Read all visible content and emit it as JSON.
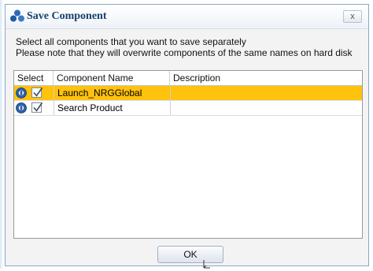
{
  "dialog": {
    "title": "Save Component",
    "close_label": "x",
    "app_icon": "components-icon"
  },
  "instructions": {
    "line1": "Select all components that you want to save separately",
    "line2": "Please note that they will overwrite components of the same names on hard disk"
  },
  "grid": {
    "columns": [
      "Select",
      "Component Name",
      "Description"
    ],
    "rows": [
      {
        "checked": true,
        "name": "Launch_NRGGlobal",
        "description": "",
        "selected": true,
        "icon": "component-icon"
      },
      {
        "checked": true,
        "name": "Search Product",
        "description": "",
        "selected": false,
        "icon": "component-icon"
      }
    ]
  },
  "buttons": {
    "ok_label": "OK"
  },
  "colors": {
    "selected_row": "#ffc20d",
    "title_text": "#16416f",
    "icon_blue": "#2b6cb5"
  }
}
